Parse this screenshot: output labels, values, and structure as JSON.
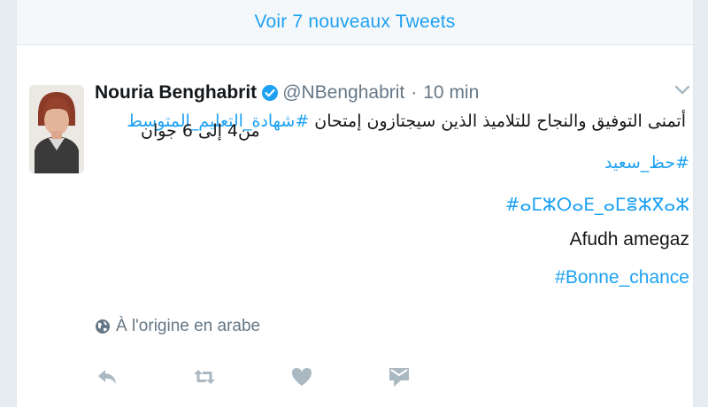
{
  "banner": {
    "new_tweets_label": "Voir 7 nouveaux Tweets"
  },
  "tweet": {
    "author_name": "Nouria Benghabrit",
    "handle": "@NBenghabrit",
    "separator": "·",
    "time": "10 min",
    "body_line1_text": "أتمنى التوفيق والنجاح للتلاميذ الذين سيجتازون إمتحان",
    "body_line1_hashtag": "#شهادة_التعليم_المتوسط",
    "body_line2": "من4 إلى 6 جوان",
    "hashtag_arabic": "#حظ_سعيد",
    "hashtag_tifinagh": "#ⴰⵎⵣⵔⴰⴹ_ⴰⵎⴻⵣⴳⴰⵣ",
    "plain_text": "Afudh amegaz",
    "hashtag_french": "#Bonne_chance",
    "origin_label": "À l'origine en arabe"
  },
  "colors": {
    "accent": "#1da1f2",
    "text": "#14171a",
    "muted": "#657786",
    "icon": "#aab8c2",
    "background": "#e6ecf0"
  },
  "icons": {
    "verified": "verified-badge-icon",
    "chevron": "chevron-down-icon",
    "globe": "globe-icon",
    "reply": "reply-icon",
    "retweet": "retweet-icon",
    "like": "heart-icon",
    "message": "direct-message-icon"
  }
}
